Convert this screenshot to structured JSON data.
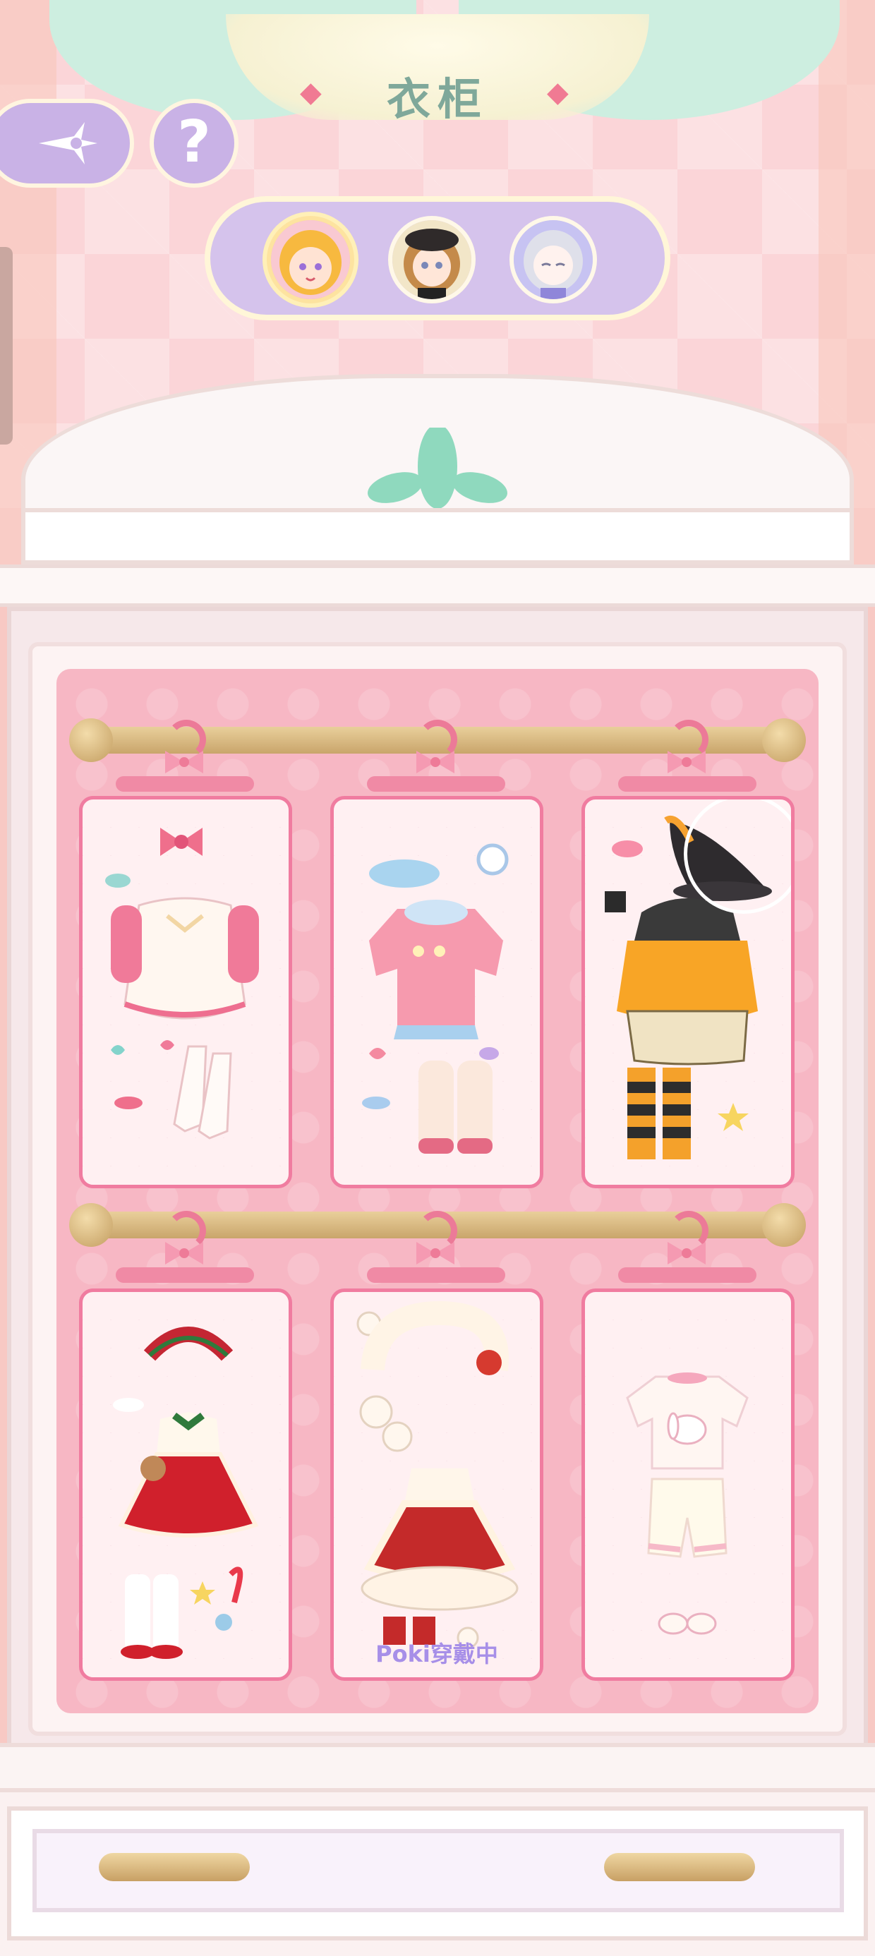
{
  "header": {
    "title": "衣柜",
    "back_icon": "sparkle-back-icon",
    "help_label": "?"
  },
  "characters": [
    {
      "name": "character-blonde",
      "selected": true
    },
    {
      "name": "character-brown-hat",
      "selected": false
    },
    {
      "name": "character-silver",
      "selected": false
    }
  ],
  "wardrobe": {
    "outfits": [
      {
        "id": "outfit-pink-bow-dress",
        "selected": false
      },
      {
        "id": "outfit-pink-sweater",
        "selected": false
      },
      {
        "id": "outfit-halloween-witch",
        "selected": true
      },
      {
        "id": "outfit-christmas-dress",
        "selected": false
      },
      {
        "id": "outfit-red-lantern-dress",
        "wearing_label": "Poki穿戴中"
      },
      {
        "id": "outfit-bunny-tee",
        "selected": false
      }
    ]
  },
  "colors": {
    "accent_pink": "#f07ca0",
    "lavender": "#c9b2e6",
    "title_green": "#7fa89a",
    "wearing_label": "#a78fe8"
  }
}
